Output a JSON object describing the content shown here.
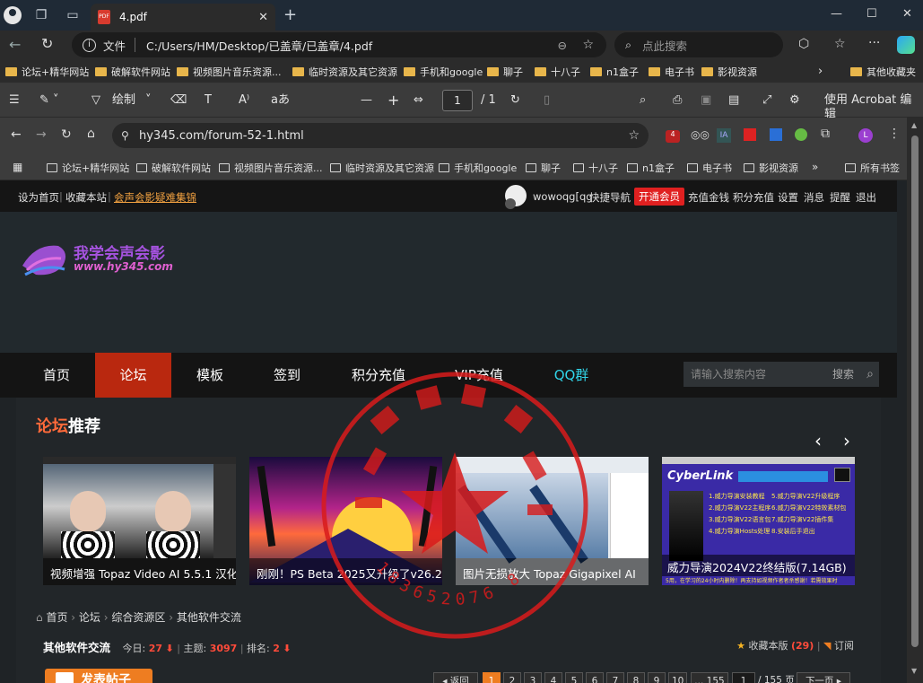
{
  "edge_tab": {
    "title": "4.pdf"
  },
  "edge_address": {
    "label": "文件",
    "url": "C:/Users/HM/Desktop/已盖章/已盖章/4.pdf",
    "search_placeholder": "点此搜索"
  },
  "edge_favorites": [
    "论坛+精华网站",
    "破解软件网站",
    "视频图片音乐资源...",
    "临时资源及其它资源",
    "手机和google",
    "聊子",
    "十八子",
    "n1盒子",
    "电子书",
    "影视资源",
    "其他收藏夹"
  ],
  "pdf_toolbar": {
    "draw_label": "绘制",
    "page_current": "1",
    "page_total": "/ 1",
    "acrobat_label": "使用 Acrobat 编辑"
  },
  "chrome": {
    "url": "hy345.com/forum-52-1.html",
    "extension_badge": "4",
    "profile_initial": "L"
  },
  "chrome_bookmarks": [
    "论坛+精华网站",
    "破解软件网站",
    "视频图片音乐资源...",
    "临时资源及其它资源",
    "手机和google",
    "聊子",
    "十八子",
    "n1盒子",
    "电子书",
    "影视资源",
    "所有书签"
  ],
  "site_topbar": {
    "set_home": "设为首页",
    "bookmark": "收藏本站",
    "faq_link": "会声会影疑难集锦",
    "username": "wowoqg[qg",
    "quick_nav": "快捷导航",
    "vip_button": "开通会员",
    "links": [
      "充值金钱",
      "积分充值",
      "设置",
      "消息",
      "提醒",
      "退出"
    ]
  },
  "logo": {
    "cn": "我学会声会影",
    "url": "www.hy345.com"
  },
  "nav": {
    "items": [
      "首页",
      "论坛",
      "模板",
      "签到",
      "积分充值",
      "VIP充值",
      "QQ群"
    ],
    "search_placeholder": "请输入搜索内容",
    "search_button": "搜索"
  },
  "recommend": {
    "title_a": "论坛",
    "title_b": "推荐"
  },
  "cards": [
    {
      "caption": "视频增强 Topaz Video AI 5.5.1 汉化"
    },
    {
      "caption": "刚刚！PS Beta 2025又升级了v26.2"
    },
    {
      "caption": "图片无损放大 Topaz Gigapixel AI"
    },
    {
      "caption": "威力导演2024V22终结版(7.14GB)",
      "brand": "CyberLink",
      "list": [
        "1.威力导演安装教程",
        "2.威力导演V22主程序",
        "3.威力导演V22语言包",
        "4.威力导演Hosts处理",
        "5.威力导演V22升级程序",
        "6.威力导演V22特效素材包",
        "7.威力导演V22插件集",
        "8.安装后手退出"
      ],
      "footer": "5用，在学习的24小时内删除！再支持如视频作者者杀感谢！若需效果时"
    }
  ],
  "breadcrumb": [
    "首页",
    "论坛",
    "综合资源区",
    "其他软件交流"
  ],
  "forum_info": {
    "name": "其他软件交流",
    "today_label": "今日:",
    "today": "27",
    "topics_label": "主题:",
    "topics": "3097",
    "rank_label": "排名:",
    "rank": "2",
    "favorite": "收藏本版",
    "favorite_count": "(29)",
    "subscribe": "订阅"
  },
  "pagination": {
    "post_button": "发表帖子",
    "prev": "返回",
    "pages": [
      "1",
      "2",
      "3",
      "4",
      "5",
      "6",
      "7",
      "8",
      "9",
      "10"
    ],
    "ellipsis": "... 155",
    "page_input": "1",
    "total": "/ 155 页",
    "next": "下一页"
  },
  "stamp": {
    "number": "183652076 8"
  },
  "colors": {
    "accent_red": "#b9280f",
    "stamp_red": "#d81b1b",
    "orange": "#ee7d21"
  }
}
